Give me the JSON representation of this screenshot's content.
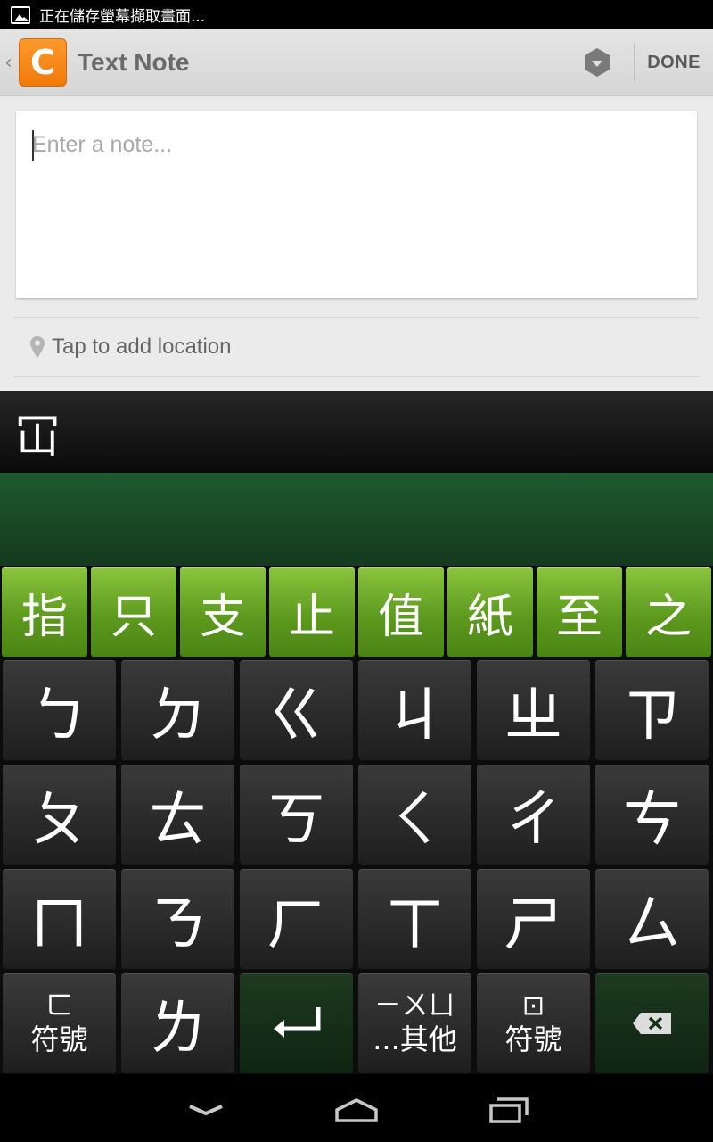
{
  "status_bar": {
    "message": "正在儲存螢幕擷取畫面..."
  },
  "action_bar": {
    "logo_letter": "C",
    "title": "Text Note",
    "done_label": "DONE"
  },
  "note": {
    "placeholder": "Enter a note..."
  },
  "location": {
    "label": "Tap to add location"
  },
  "composing": {
    "text": "冚"
  },
  "candidates": [
    "指",
    "只",
    "支",
    "止",
    "值",
    "紙",
    "至",
    "之"
  ],
  "keyboard": {
    "rows": [
      [
        "ㄅ",
        "ㄉ",
        "ㄍ",
        "ㄐ",
        "ㄓ",
        "ㄗ"
      ],
      [
        "ㄆ",
        "ㄊ",
        "ㄎ",
        "ㄑ",
        "ㄔ",
        "ㄘ"
      ],
      [
        "ㄇ",
        "ㄋ",
        "ㄏ",
        "ㄒ",
        "ㄕ",
        "ㄙ"
      ]
    ],
    "bottom": {
      "symbols1_top": "ㄈ",
      "symbols1_label": "符號",
      "key_l": "ㄌ",
      "other_top": "ㄧㄨㄩ",
      "other_label": "...其他",
      "symbols2_top": "⊡",
      "symbols2_label": "符號"
    }
  },
  "colors": {
    "candidate_green": "#6aaa22",
    "action_accent": "#f5861a"
  }
}
